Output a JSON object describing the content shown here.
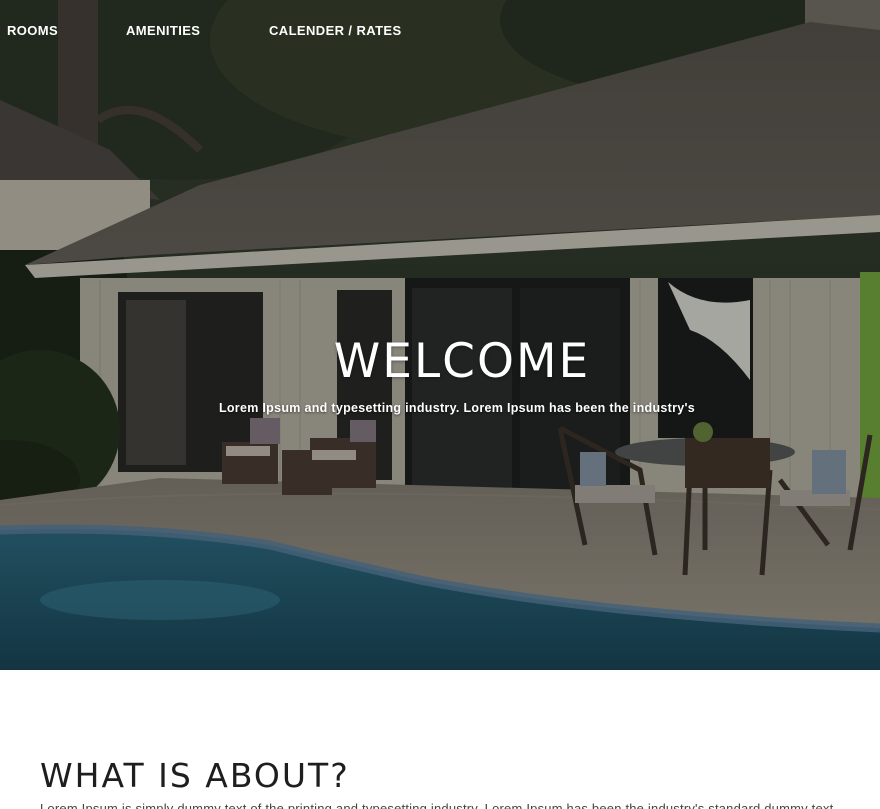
{
  "nav": {
    "items": [
      {
        "label": "ROOMS"
      },
      {
        "label": "AMENITIES"
      },
      {
        "label": "CALENDER / RATES"
      }
    ]
  },
  "hero": {
    "title": "WELCOME",
    "subtitle": "Lorem Ipsum and typesetting industry. Lorem Ipsum has been the industry's",
    "image_description_icon": "house-with-pool-photo"
  },
  "about": {
    "title": "WHAT IS ABOUT?",
    "text": "Lorem Ipsum is simply dummy text of the printing and typesetting industry. Lorem Ipsum has been the industry's standard dummy text"
  },
  "colors": {
    "hero_overlay": "#000000",
    "nav_text": "#ffffff",
    "heading_text": "#1e1e1e",
    "body_text": "#444444",
    "page_background": "#ffffff"
  }
}
